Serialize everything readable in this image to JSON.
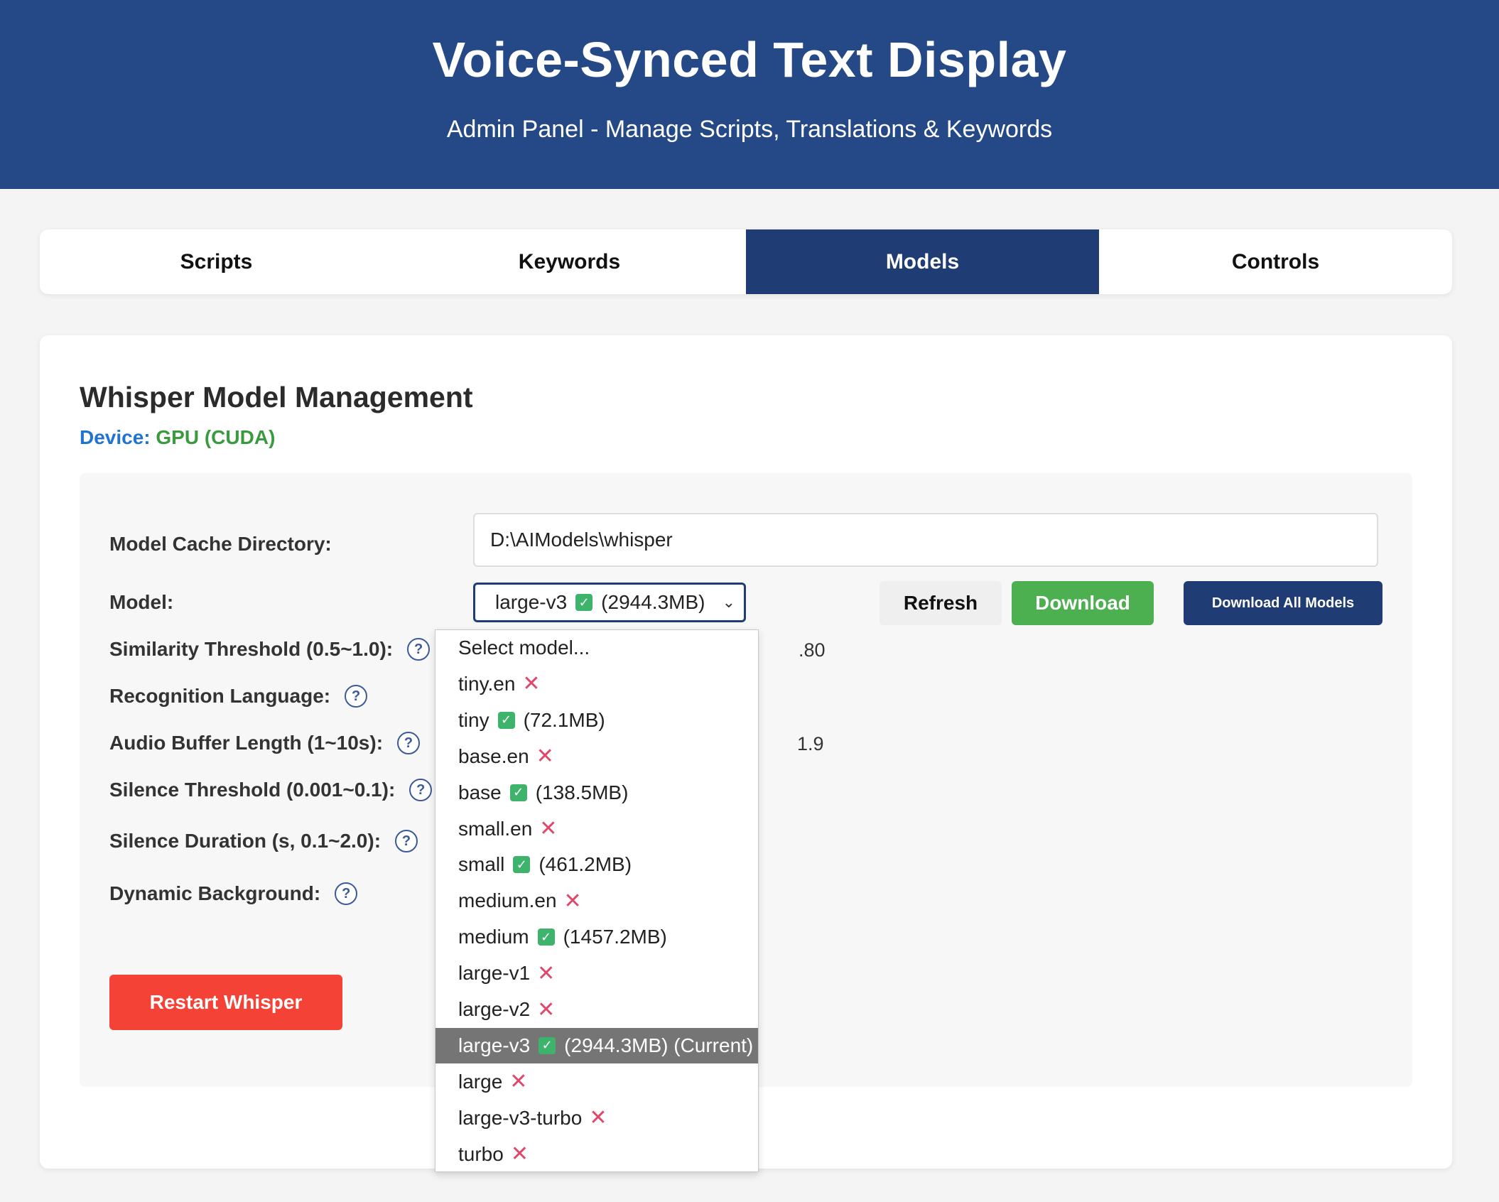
{
  "header": {
    "title": "Voice-Synced Text Display",
    "subtitle": "Admin Panel - Manage Scripts, Translations & Keywords"
  },
  "tabs": [
    {
      "label": "Scripts",
      "active": false
    },
    {
      "label": "Keywords",
      "active": false
    },
    {
      "label": "Models",
      "active": true
    },
    {
      "label": "Controls",
      "active": false
    }
  ],
  "card": {
    "title": "Whisper Model Management",
    "device_label": "Device:",
    "device_value": "GPU (CUDA)"
  },
  "form": {
    "cache_dir_label": "Model Cache Directory:",
    "cache_dir_value": "D:\\AIModels\\whisper",
    "model_label": "Model:",
    "model_selected_name": "large-v3",
    "model_selected_size": "(2944.3MB)",
    "similarity_label": "Similarity Threshold (0.5~1.0):",
    "similarity_value_partial": ".80",
    "language_label": "Recognition Language:",
    "buffer_label": "Audio Buffer Length (1~10s):",
    "buffer_value_partial": "1.9",
    "silence_threshold_label": "Silence Threshold (0.001~0.1):",
    "silence_duration_label": "Silence Duration (s, 0.1~2.0):",
    "dynamic_bg_label": "Dynamic Background:",
    "help_symbol": "?"
  },
  "buttons": {
    "refresh": "Refresh",
    "download": "Download",
    "download_all": "Download All Models",
    "restart": "Restart Whisper"
  },
  "dropdown_options": [
    {
      "name": "Select model...",
      "status": "none",
      "size": ""
    },
    {
      "name": "tiny.en",
      "status": "missing",
      "size": ""
    },
    {
      "name": "tiny",
      "status": "downloaded",
      "size": "(72.1MB)"
    },
    {
      "name": "base.en",
      "status": "missing",
      "size": ""
    },
    {
      "name": "base",
      "status": "downloaded",
      "size": "(138.5MB)"
    },
    {
      "name": "small.en",
      "status": "missing",
      "size": ""
    },
    {
      "name": "small",
      "status": "downloaded",
      "size": "(461.2MB)"
    },
    {
      "name": "medium.en",
      "status": "missing",
      "size": ""
    },
    {
      "name": "medium",
      "status": "downloaded",
      "size": "(1457.2MB)"
    },
    {
      "name": "large-v1",
      "status": "missing",
      "size": ""
    },
    {
      "name": "large-v2",
      "status": "missing",
      "size": ""
    },
    {
      "name": "large-v3",
      "status": "downloaded",
      "size": "(2944.3MB) (Current)",
      "selected": true
    },
    {
      "name": "large",
      "status": "missing",
      "size": ""
    },
    {
      "name": "large-v3-turbo",
      "status": "missing",
      "size": ""
    },
    {
      "name": "turbo",
      "status": "missing",
      "size": ""
    }
  ],
  "icons": {
    "check": "✓",
    "cross": "✕",
    "chevron": "⌄"
  },
  "colors": {
    "header_bg": "#254886",
    "active_tab": "#1f3c74",
    "device_label": "#1f73d1",
    "device_value": "#3a9a3e",
    "download_btn": "#4caf50",
    "restart_btn": "#f44336",
    "check_green": "#3db36b",
    "cross_red": "#e0476b"
  }
}
